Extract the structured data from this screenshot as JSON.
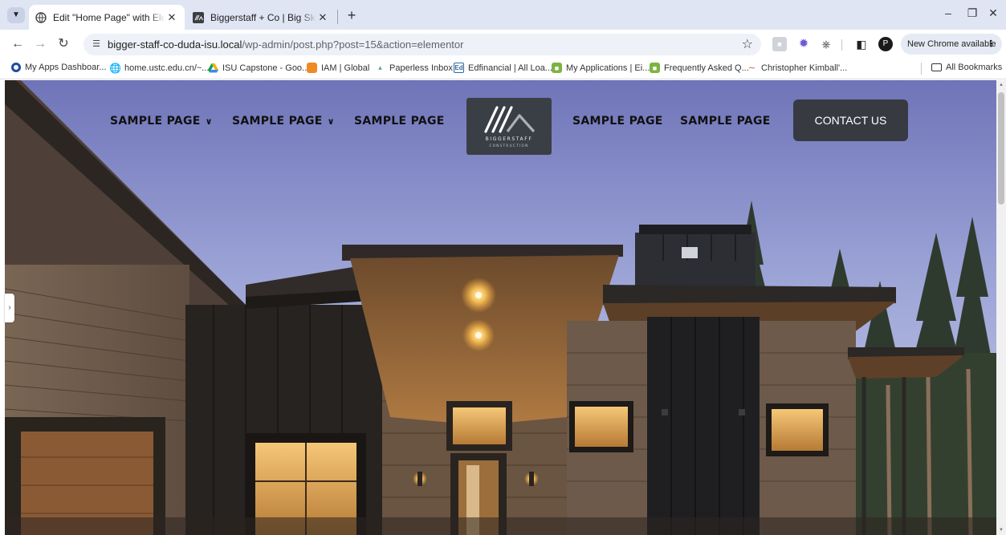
{
  "browser": {
    "tabs": [
      {
        "title": "Edit \"Home Page\" with Elementor",
        "active": true
      },
      {
        "title": "Biggerstaff + Co | Big Sky Montana",
        "active": false
      }
    ],
    "url_host": "bigger-staff-co-duda-isu.local",
    "url_path": "/wp-admin/post.php?post=15&action=elementor",
    "update_label": "New Chrome available",
    "profile_initial": "P",
    "bookmarks": [
      {
        "label": "My Apps Dashboar...",
        "icon": "circle-icon",
        "color": "#1f4aa8"
      },
      {
        "label": "home.ustc.edu.cn/~...",
        "icon": "globe-icon",
        "color": "#555555"
      },
      {
        "label": "ISU Capstone - Goo...",
        "icon": "drive-icon",
        "color": "#f4b400"
      },
      {
        "label": "IAM | Global",
        "icon": "cube-icon",
        "color": "#f08a24"
      },
      {
        "label": "Paperless Inbox",
        "icon": "paperless-icon",
        "color": "#4caf7a"
      },
      {
        "label": "Edfinancial | All Loa...",
        "icon": "ed-icon",
        "color": "#2d6a9f"
      },
      {
        "label": "My Applications | Ei...",
        "icon": "apps-icon",
        "color": "#7cb342"
      },
      {
        "label": "Frequently Asked Q...",
        "icon": "faq-icon",
        "color": "#7cb342"
      },
      {
        "label": "Christopher Kimball'...",
        "icon": "ck-icon",
        "color": "#d08a6a"
      }
    ],
    "all_bookmarks_label": "All Bookmarks"
  },
  "site": {
    "nav_left": [
      {
        "label": "SAMPLE PAGE",
        "has_dropdown": true
      },
      {
        "label": "SAMPLE PAGE",
        "has_dropdown": true
      },
      {
        "label": "SAMPLE PAGE",
        "has_dropdown": false
      }
    ],
    "nav_right": [
      {
        "label": "SAMPLE PAGE"
      },
      {
        "label": "SAMPLE PAGE"
      }
    ],
    "logo_name": "BIGGERSTAFF",
    "logo_sub": "CONSTRUCTION",
    "contact_label": "CONTACT US"
  },
  "colors": {
    "tabstrip": "#dfe5f3",
    "nav_text": "#111111",
    "button_bg": "#373b41",
    "logo_bg": "#3a3f45"
  }
}
